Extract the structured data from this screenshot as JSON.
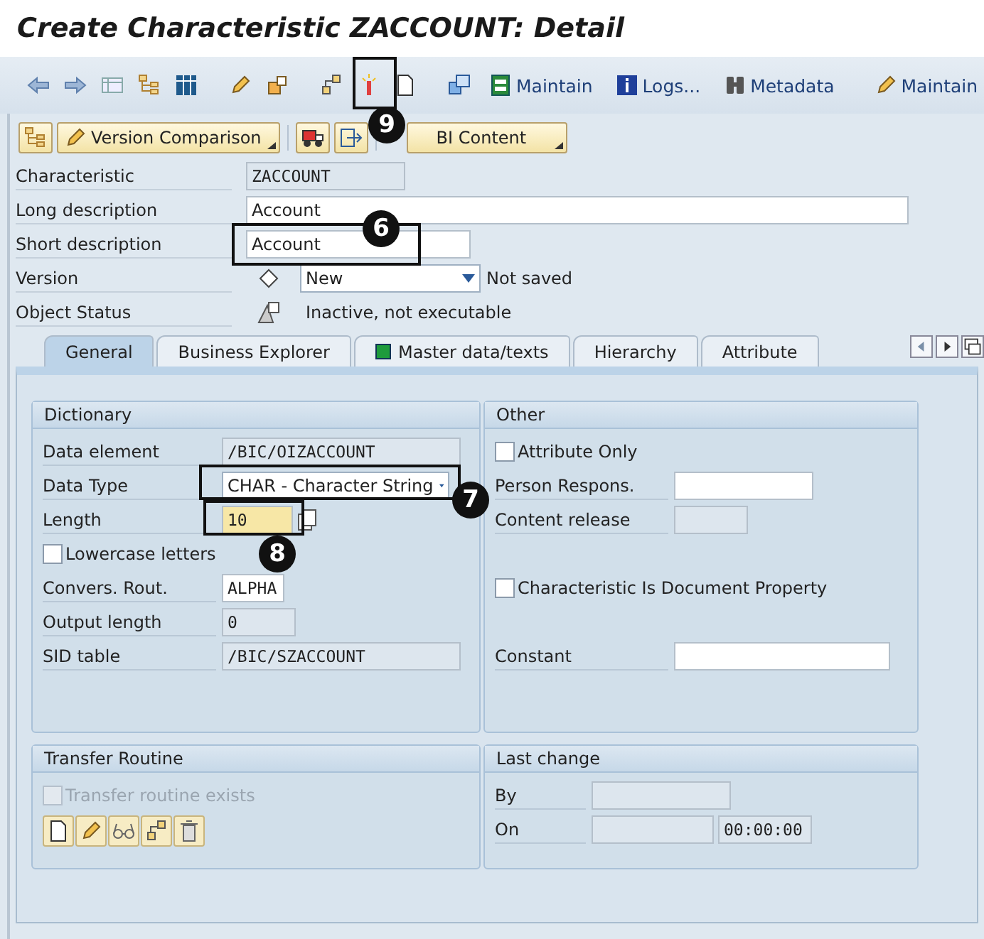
{
  "window": {
    "title": "Create Characteristic ZACCOUNT: Detail"
  },
  "toolbar": [
    {
      "kind": "icon"
    },
    {
      "kind": "icon"
    },
    {
      "kind": "icon"
    },
    {
      "kind": "icon"
    },
    {
      "kind": "icon"
    },
    {
      "kind": "separator"
    },
    {
      "kind": "icon"
    },
    {
      "kind": "icon"
    },
    {
      "kind": "separator"
    },
    {
      "kind": "icon"
    },
    {
      "kind": "icon"
    },
    {
      "kind": "icon"
    },
    {
      "kind": "separator"
    },
    {
      "kind": "icon"
    },
    {
      "kind": "button",
      "label": "Maintain"
    },
    {
      "kind": "button",
      "label": "Logs..."
    },
    {
      "kind": "button",
      "label": "Metadata"
    },
    {
      "kind": "separator"
    },
    {
      "kind": "button",
      "label": "Maintain"
    }
  ],
  "app_toolbar": [
    {
      "kind": "icon"
    },
    {
      "kind": "menu",
      "label": "Version Comparison"
    },
    {
      "kind": "separator"
    },
    {
      "kind": "icon"
    },
    {
      "kind": "icon"
    },
    {
      "kind": "separator"
    },
    {
      "kind": "menu",
      "label": "BI Content"
    }
  ],
  "header": [
    {
      "label": "Characteristic",
      "kind": "display",
      "value": "ZACCOUNT"
    },
    {
      "label": "Long description",
      "kind": "text",
      "value": "Account"
    },
    {
      "label": "Short description",
      "kind": "text",
      "value": "Account"
    },
    {
      "label": "Version",
      "kind": "dropdown",
      "value": "New",
      "note": "Not saved"
    },
    {
      "label": "Object Status",
      "kind": "status",
      "value": "Inactive, not executable"
    }
  ],
  "tabs": [
    {
      "label": "General",
      "selected": true
    },
    {
      "label": "Business Explorer",
      "selected": false
    },
    {
      "label": "Master data/texts",
      "selected": false,
      "color": "#1e9b3c"
    },
    {
      "label": "Hierarchy",
      "selected": false
    },
    {
      "label": "Attribute",
      "selected": false
    }
  ],
  "dictionary": {
    "title": "Dictionary",
    "rows": [
      {
        "kind": "display_field",
        "label": "Data element",
        "value": "/BIC/OIZACCOUNT"
      },
      {
        "kind": "dropdown_field",
        "label": "Data Type",
        "value": "CHAR - Character String"
      },
      {
        "kind": "entry_field",
        "label": "Length",
        "value": "10",
        "focused": true
      },
      {
        "kind": "checkbox",
        "label": "Lowercase letters",
        "checked": false,
        "disabled": false
      },
      {
        "kind": "entry_field",
        "label": "Convers. Rout.",
        "value": "ALPHA"
      },
      {
        "kind": "display_field",
        "label": "Output length",
        "value": "0"
      },
      {
        "kind": "display_field",
        "label": "SID table",
        "value": "/BIC/SZACCOUNT"
      }
    ]
  },
  "other": {
    "title": "Other",
    "rows": [
      {
        "kind": "checkbox",
        "label": "Attribute Only",
        "checked": false,
        "disabled": false
      },
      {
        "kind": "entry_field",
        "label": "Person Respons."
      },
      {
        "kind": "display_field",
        "label": "Content release"
      },
      {
        "kind": "checkbox",
        "label": "Characteristic Is Document Property",
        "checked": false,
        "disabled": false
      },
      {
        "kind": "entry_field",
        "label": "Constant"
      }
    ]
  },
  "transfer_routine": {
    "title": "Transfer Routine",
    "rows": [
      {
        "kind": "checkbox",
        "label": "Transfer routine exists",
        "checked": false,
        "disabled": true
      }
    ],
    "buttons": [
      {
        "kind": "icon"
      },
      {
        "kind": "icon"
      },
      {
        "kind": "icon"
      },
      {
        "kind": "icon"
      },
      {
        "kind": "icon"
      }
    ]
  },
  "last_change": {
    "title": "Last change",
    "rows": [
      {
        "kind": "display_field",
        "label": "By"
      },
      {
        "kind": "display_field",
        "label": "On",
        "time": "00:00:00"
      }
    ]
  },
  "callouts": [
    {
      "number": "9"
    },
    {
      "number": "6"
    },
    {
      "number": "7"
    },
    {
      "number": "8"
    }
  ]
}
